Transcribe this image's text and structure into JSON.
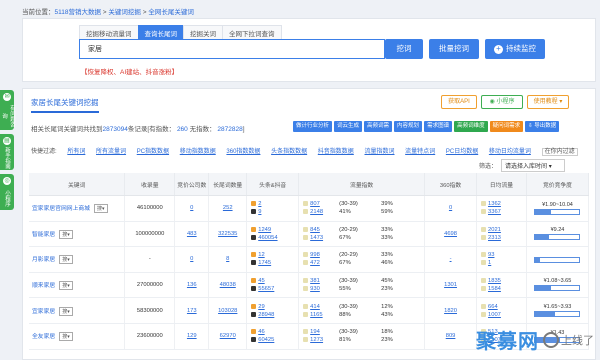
{
  "breadcrumb": {
    "prefix": "当前位置：",
    "items": [
      "5118营销大数据",
      "关键词挖掘",
      "全网长尾关键词"
    ]
  },
  "side_tabs": [
    {
      "label": "有问题咨询",
      "icon": "chat-icon"
    },
    {
      "label": "新手指南",
      "icon": "book-icon"
    },
    {
      "label": "小程序",
      "icon": "miniapp-icon"
    }
  ],
  "search": {
    "tabs": [
      "挖掘移动流量词",
      "查询长尾词",
      "挖掘关词",
      "全网下拉词查询"
    ],
    "active_tab": 1,
    "value": "家居",
    "btn_search": "挖词",
    "btn_batch": "批量挖词",
    "btn_monitor": "持续监控",
    "warning": "【恢复降权、AI建站、抖音涨粉】"
  },
  "panel": {
    "title": "家居长尾关键词挖掘",
    "api_label": "获取API",
    "mini_label": "小程序",
    "tutorial_label": "使用教程",
    "stat_prefix": "相关长尾词关键词共找到",
    "stat_total": "2873094",
    "stat_mid": "条记录[有指数：",
    "stat_index": "260",
    "stat_mid2": "无指数：",
    "stat_noindex": "2872828",
    "stat_end": "]",
    "toolbar": [
      "做计行业分析",
      "词云生成",
      "高频词需",
      "内容规划",
      "需求图谱",
      "高频词维度",
      "疑问词需求",
      "导出数据"
    ],
    "filters": [
      "快捷过滤:",
      "所有词",
      "所有流量词",
      "PC指数数据",
      "移动指数数据",
      "360指数数据",
      "头条指数数据",
      "抖音指数数据",
      "流量指数词",
      "流量特点词",
      "PC日均数据",
      "移动日均流量词"
    ],
    "filter_action": "在你内过滤",
    "select_label": "筛选：",
    "select_value": "请选择入库时间"
  },
  "table": {
    "headers": [
      "关键词",
      "收录量",
      "竞价公司数",
      "长尾词数量",
      "头条&抖音",
      "流量指数",
      "360指数",
      "日均流量",
      "竞价竞争度"
    ],
    "rows": [
      {
        "kw": "宜家家居官网网上商城",
        "engine": "搜",
        "index": "46100000",
        "bid": "0",
        "long": "252",
        "tt": [
          "2",
          "9"
        ],
        "flow": [
          "807",
          "2148"
        ],
        "range": [
          "(30-39)",
          "41%"
        ],
        "pct": [
          "39%",
          "59%"
        ],
        "s360": "0",
        "daily": [
          "1362",
          "3367"
        ],
        "price": "¥1.90~10.04",
        "fill": 0.35
      },
      {
        "kw": "智能家居",
        "engine": "搜",
        "index": "100000000",
        "bid": "483",
        "long": "322535",
        "tt": [
          "1249",
          "460054"
        ],
        "flow": [
          "845",
          "1473"
        ],
        "range": [
          "(20-29)",
          "67%"
        ],
        "pct": [
          "33%",
          "33%"
        ],
        "s360": "4698",
        "daily": [
          "2021",
          "2313"
        ],
        "price": "¥9.24",
        "fill": 0.3
      },
      {
        "kw": "月影家居",
        "engine": "搜",
        "index": "-",
        "bid": "0",
        "long": "8",
        "tt": [
          "12",
          "1745"
        ],
        "flow": [
          "998",
          "472"
        ],
        "range": [
          "(20-29)",
          "67%"
        ],
        "pct": [
          "33%",
          "46%"
        ],
        "s360": "-",
        "daily": [
          "93",
          "1"
        ],
        "price": "",
        "fill": 0.1
      },
      {
        "kw": "顺来家居",
        "engine": "搜",
        "index": "27000000",
        "bid": "136",
        "long": "48038",
        "tt": [
          "45",
          "55657"
        ],
        "flow": [
          "381",
          "930"
        ],
        "range": [
          "(30-39)",
          "55%"
        ],
        "pct": [
          "45%",
          "23%"
        ],
        "s360": "1301",
        "daily": [
          "1835",
          "1584"
        ],
        "price": "¥1.08~3.65",
        "fill": 0.35
      },
      {
        "kw": "宜家家居",
        "engine": "搜",
        "index": "58300000",
        "bid": "173",
        "long": "103028",
        "tt": [
          "29",
          "28948"
        ],
        "flow": [
          "414",
          "1165"
        ],
        "range": [
          "(30-39)",
          "88%"
        ],
        "pct": [
          "12%",
          "43%"
        ],
        "s360": "1820",
        "daily": [
          "664",
          "1007"
        ],
        "price": "¥1.65~3.93",
        "fill": 0.45
      },
      {
        "kw": "全友家居",
        "engine": "搜",
        "index": "23600000",
        "bid": "129",
        "long": "62970",
        "tt": [
          "46",
          "60425"
        ],
        "flow": [
          "194",
          "1273"
        ],
        "range": [
          "(30-39)",
          "81%"
        ],
        "pct": [
          "18%",
          "23%"
        ],
        "s360": "809",
        "daily": [
          "513",
          "2107"
        ],
        "price": "¥1.43",
        "fill": 0.55
      }
    ]
  },
  "watermark": {
    "brand": "聚募网",
    "sub": "上线了"
  }
}
